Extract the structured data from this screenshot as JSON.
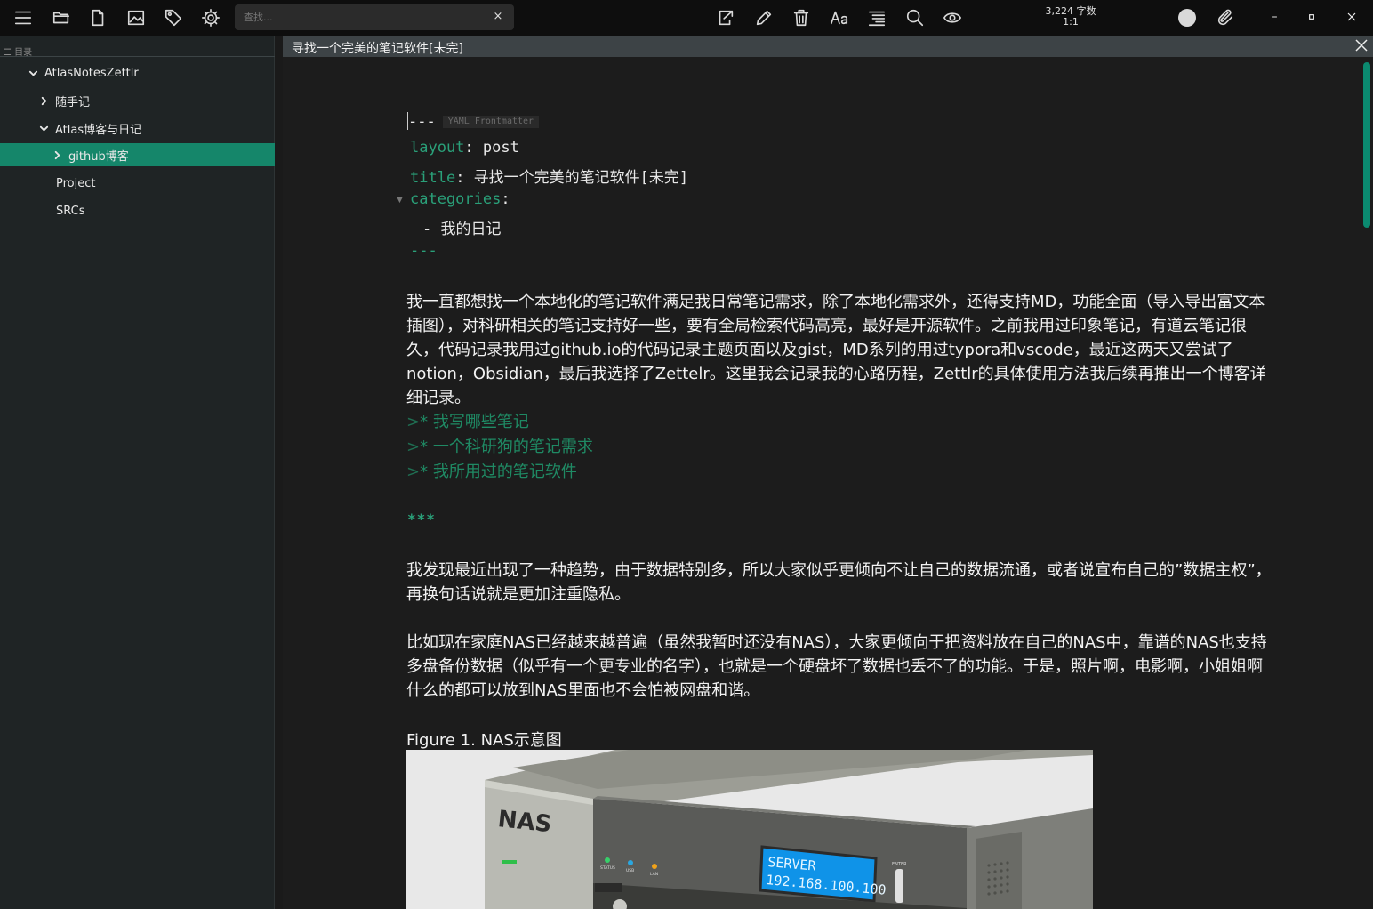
{
  "toolbar": {
    "search_placeholder": "查找...",
    "search_clear": "×",
    "word_count": "3,224 字数",
    "cursor_pos": "1:1"
  },
  "sidebar": {
    "header": "目录",
    "items": [
      {
        "label": "AtlasNotesZettlr",
        "state": "expanded",
        "active": false
      },
      {
        "label": "随手记",
        "state": "collapsed",
        "active": false
      },
      {
        "label": "Atlas博客与日记",
        "state": "expanded",
        "active": false
      },
      {
        "label": "github博客",
        "state": "collapsed",
        "active": true
      },
      {
        "label": "Project",
        "state": "none",
        "active": false
      },
      {
        "label": "SRCs",
        "state": "none",
        "active": false
      }
    ]
  },
  "editor": {
    "tab_title": "寻找一个完美的笔记软件[未完]",
    "frontmatter": {
      "delimiter": "---",
      "badge": "YAML Frontmatter",
      "layout_key": "layout",
      "layout_value": "post",
      "title_key": "title",
      "title_value": "寻找一个完美的笔记软件[未完]",
      "categories_key": "categories",
      "category_item": "- 我的日记",
      "end_delimiter": "---"
    },
    "paragraphs": [
      "我一直都想找一个本地化的笔记软件满足我日常笔记需求，除了本地化需求外，还得支持MD，功能全面（导入导出富文本插图），对科研相关的笔记支持好一些，要有全局检索代码高亮，最好是开源软件。之前我用过印象笔记，有道云笔记很久，代码记录我用过github.io的代码记录主题页面以及gist，MD系列的用过typora和vscode，最近这两天又尝试了notion，Obsidian，最后我选择了Zettelr。这里我会记录我的心路历程，Zettlr的具体使用方法我后续再推出一个博客详细记录。",
      "我发现最近出现了一种趋势，由于数据特别多，所以大家似乎更倾向不让自己的数据流通，或者说宣布自己的”数据主权”，再换句话说就是更加注重隐私。",
      "比如现在家庭NAS已经越来越普遍（虽然我暂时还没有NAS），大家更倾向于把资料放在自己的NAS中，靠谱的NAS也支持多盘备份数据（似乎有一个更专业的名字），也就是一个硬盘坏了数据也丢不了的功能。于是，照片啊，电影啊，小姐姐啊什么的都可以放到NAS里面也不会怕被网盘和谐。"
    ],
    "quotes": [
      {
        "marker": ">",
        "text": "* 我写哪些笔记"
      },
      {
        "marker": ">",
        "text": "* 一个科研狗的笔记需求"
      },
      {
        "marker": ">",
        "text": "* 我所用过的笔记软件"
      }
    ],
    "hr": "***",
    "figure_caption": "Figure 1. NAS示意图",
    "figure": {
      "brand": "NAS",
      "lcd_line1": "SERVER",
      "lcd_line2": "192.168.100.100",
      "led_labels": [
        "STATUS",
        "USB",
        "LAN"
      ],
      "enter_label": "ENTER"
    }
  }
}
